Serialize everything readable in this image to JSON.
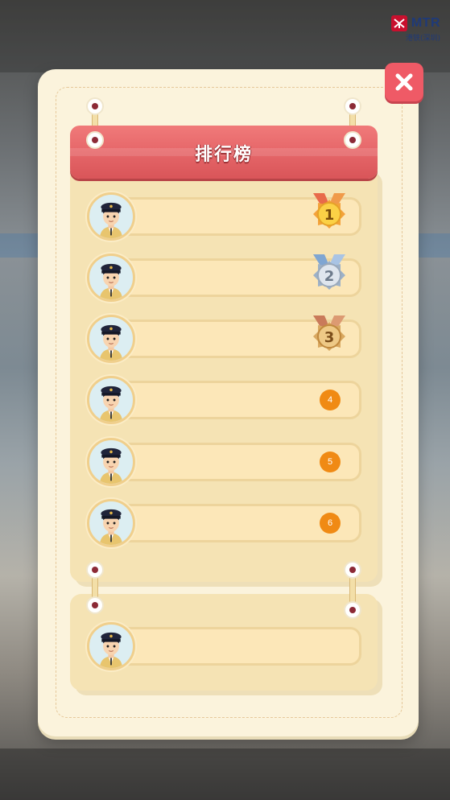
{
  "logo": {
    "brand": "MTR",
    "subtitle": "港铁(深圳)"
  },
  "leaderboard": {
    "title": "排行榜",
    "entries": [
      {
        "rank": "1",
        "medal": "gold"
      },
      {
        "rank": "2",
        "medal": "silver"
      },
      {
        "rank": "3",
        "medal": "bronze"
      },
      {
        "rank": "4"
      },
      {
        "rank": "5"
      },
      {
        "rank": "6"
      }
    ]
  },
  "colors": {
    "accent": "#ef5a66",
    "banner": "#e86a6c",
    "rank_badge": "#f08a14",
    "panel": "#fbf3dc",
    "board": "#f5e3b4"
  },
  "icons": {
    "close": "close-icon",
    "avatar": "conductor-avatar-icon",
    "medal": "medal-icon",
    "logo": "mtr-logo-icon"
  }
}
